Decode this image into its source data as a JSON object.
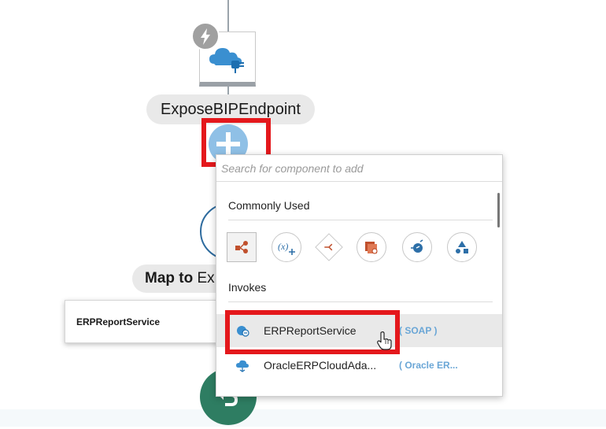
{
  "trigger": {
    "label": "ExposeBIPEndpoint"
  },
  "map_node": {
    "label_bold": "Map to",
    "label_rest": " Ex"
  },
  "tooltip": {
    "text": "ERPReportService"
  },
  "popup": {
    "search_placeholder": "Search for component to add",
    "commonly_used_label": "Commonly Used",
    "invokes_label": "Invokes",
    "commonly_used_icons": [
      "route-icon",
      "assign-variable-icon",
      "switch-icon",
      "stage-file-icon",
      "notification-icon",
      "for-each-icon"
    ],
    "invokes": [
      {
        "name": "ERPReportService",
        "type": "( SOAP )",
        "icon": "soap-connection-icon"
      },
      {
        "name": "OracleERPCloudAda...",
        "type": "( Oracle ER...",
        "icon": "erp-cloud-icon"
      }
    ]
  },
  "colors": {
    "highlight": "#e4181c",
    "add_button": "#8fc0e6",
    "return_node": "#2e7d62",
    "link_type": "#6aa6d6"
  }
}
